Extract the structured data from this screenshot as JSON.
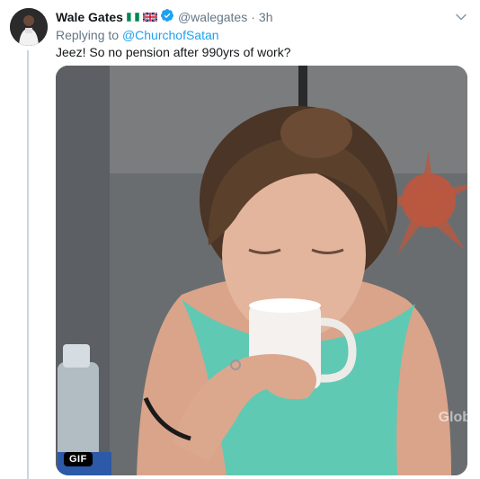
{
  "tweet": {
    "author": {
      "name": "Wale Gates",
      "handle": "@walegates",
      "flags": [
        "nigeria-flag-icon",
        "uk-flag-icon"
      ],
      "verified": true
    },
    "separator": "·",
    "time": "3h",
    "reply_prefix": "Replying to",
    "reply_mention": "@ChurchofSatan",
    "text": "Jeez! So no pension after 990yrs of work?",
    "media": {
      "type": "gif",
      "badge": "GIF",
      "watermark": "Glob"
    }
  },
  "colors": {
    "accent": "#1da1f2",
    "secondary_text": "#657786",
    "primary_text": "#14171a",
    "thread_line": "#ccd6dd"
  }
}
